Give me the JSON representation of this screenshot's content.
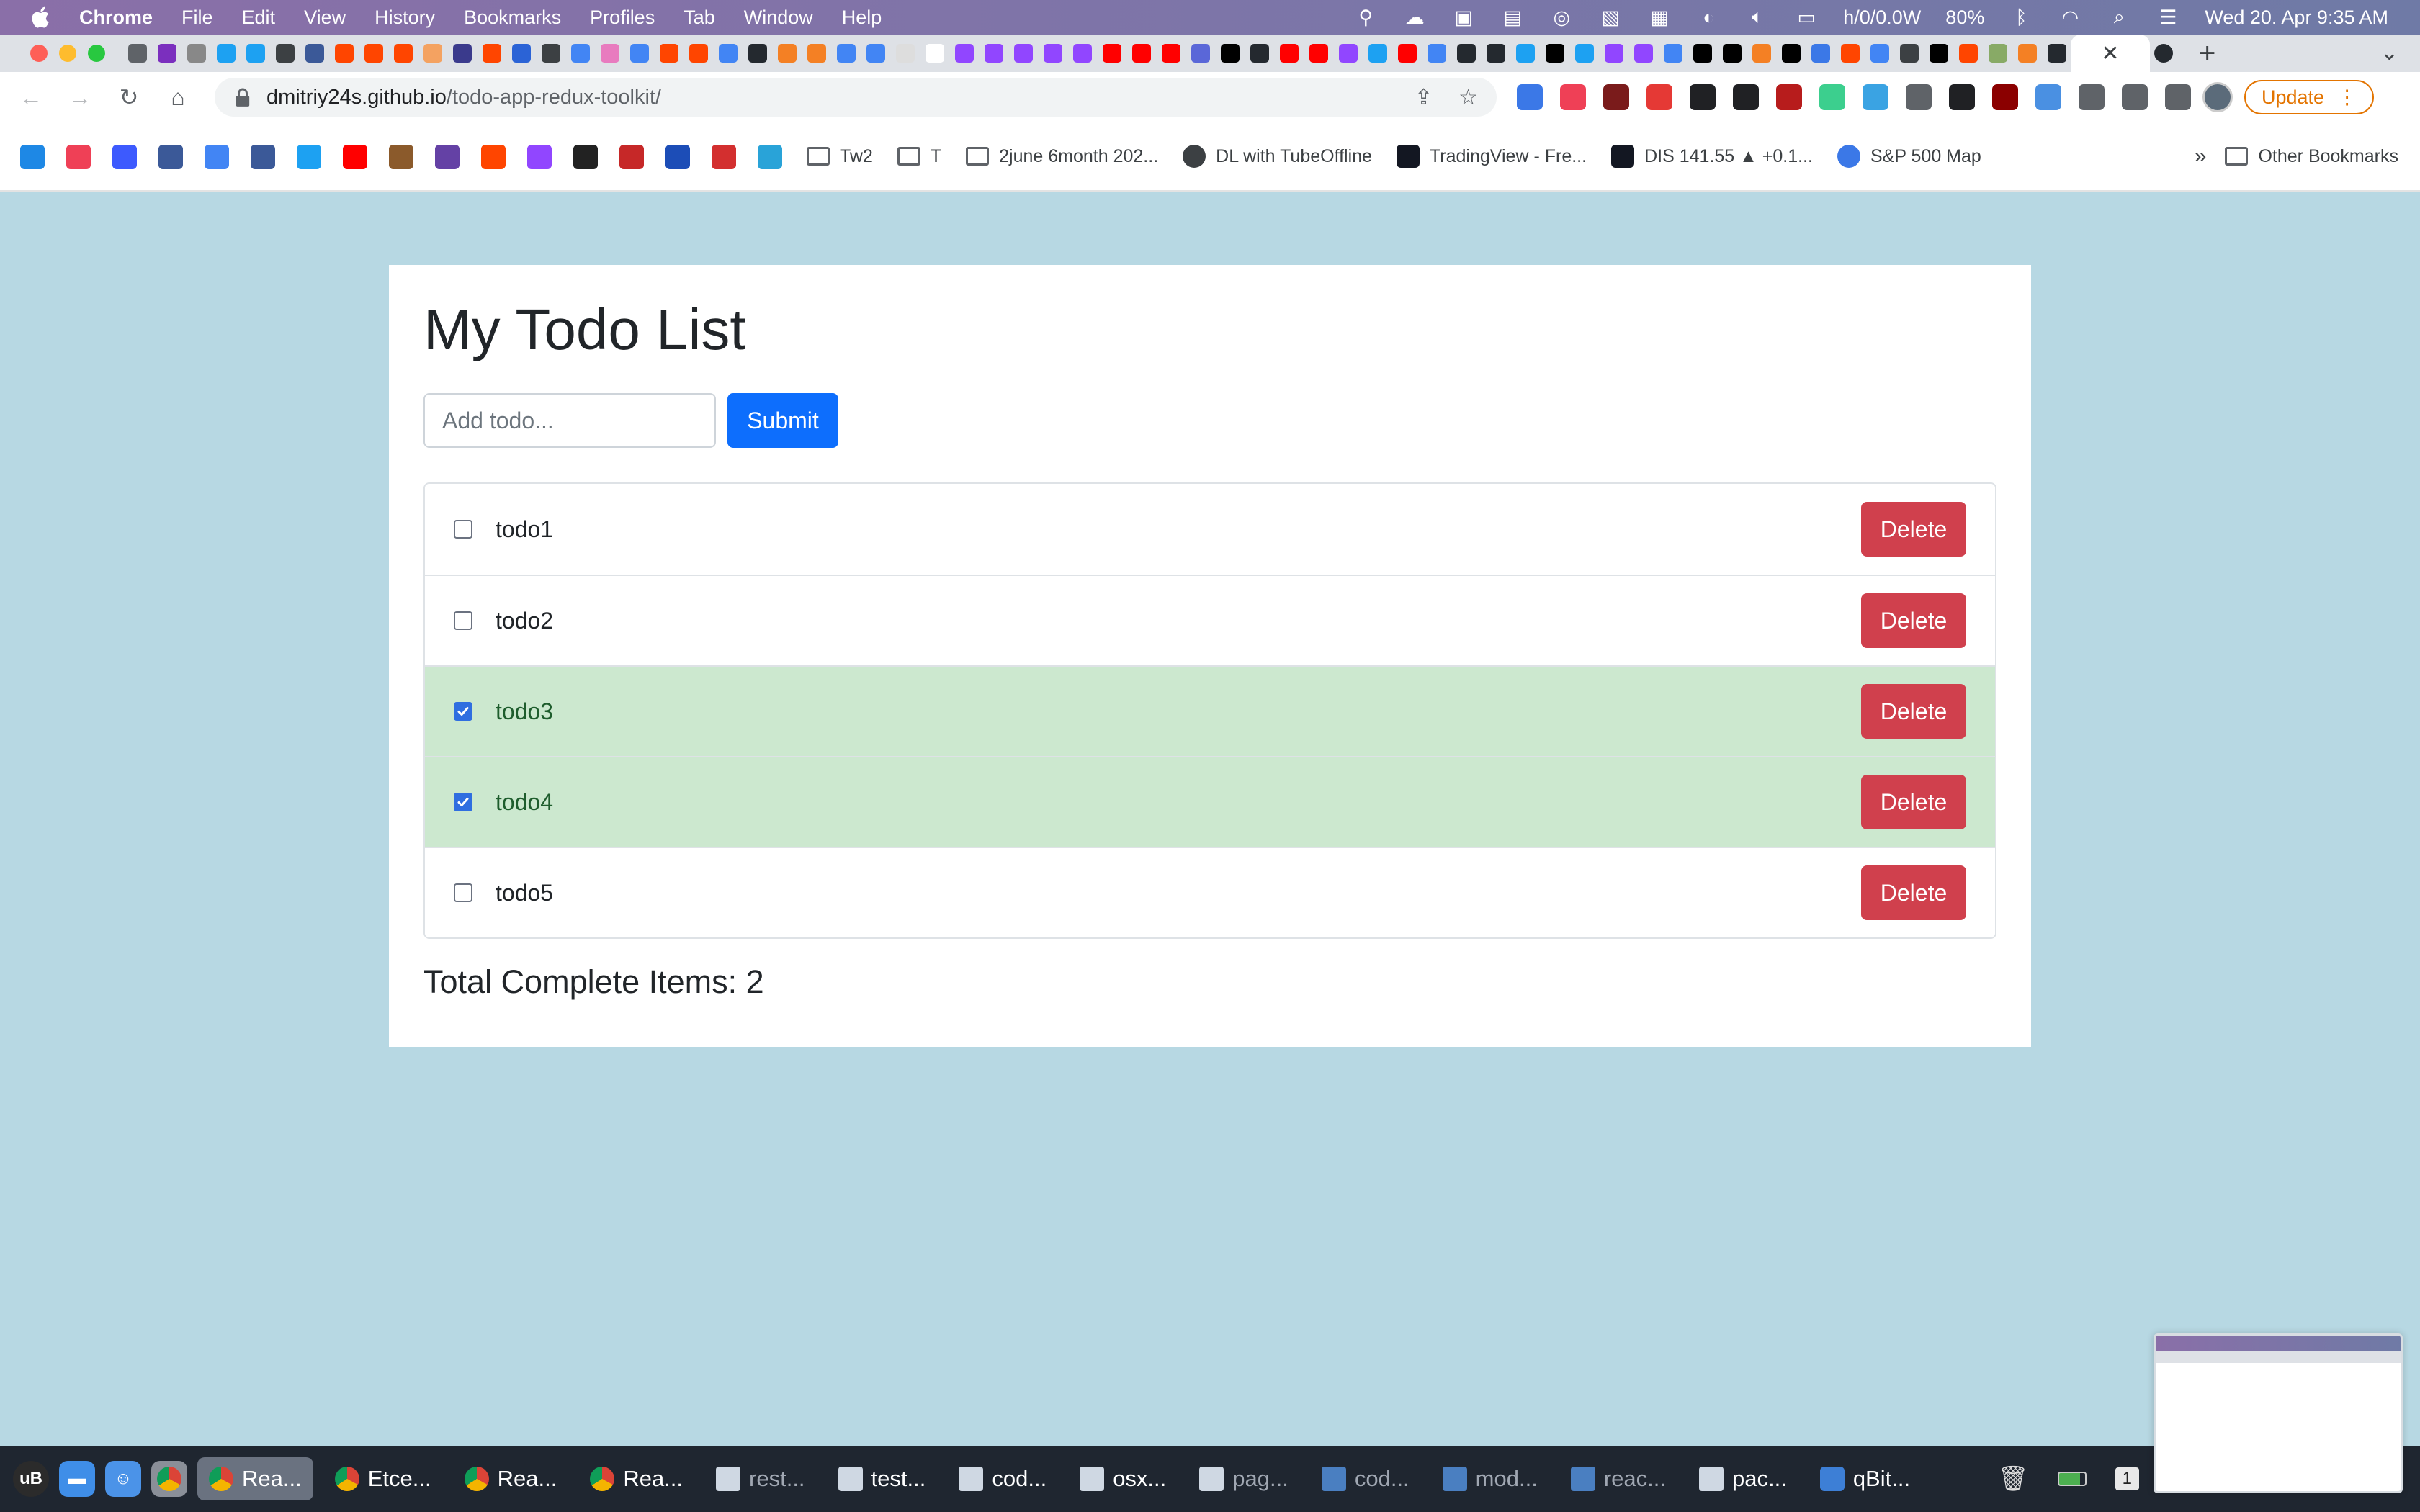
{
  "menubar": {
    "app": "Chrome",
    "items": [
      "File",
      "Edit",
      "View",
      "History",
      "Bookmarks",
      "Profiles",
      "Tab",
      "Window",
      "Help"
    ],
    "network": "h/0/0.0W",
    "battery": "80%",
    "datetime": "Wed 20. Apr  9:35 AM"
  },
  "browser": {
    "address_host": "dmitriy24s.github.io",
    "address_path": "/todo-app-redux-toolkit/",
    "update_label": "Update",
    "active_tab_close": "✕",
    "new_tab": "+"
  },
  "bookmarks": {
    "items": [
      {
        "label": "Tw2",
        "type": "folder"
      },
      {
        "label": "T",
        "type": "folder"
      },
      {
        "label": "2june 6month 202...",
        "type": "folder"
      },
      {
        "label": "DL with TubeOffline",
        "type": "link"
      },
      {
        "label": "TradingView - Fre...",
        "type": "link"
      },
      {
        "label": "DIS 141.55 ▲ +0.1...",
        "type": "link"
      },
      {
        "label": "S&P 500 Map",
        "type": "link"
      }
    ],
    "more": "»",
    "other": "Other Bookmarks"
  },
  "app": {
    "title": "My Todo List",
    "input_placeholder": "Add todo...",
    "submit_label": "Submit",
    "delete_label": "Delete",
    "todos": [
      {
        "label": "todo1",
        "completed": false
      },
      {
        "label": "todo2",
        "completed": false
      },
      {
        "label": "todo3",
        "completed": true
      },
      {
        "label": "todo4",
        "completed": true
      },
      {
        "label": "todo5",
        "completed": false
      }
    ],
    "total_label": "Total Complete Items: 2"
  },
  "dock": {
    "apps": [
      {
        "label": "Rea...",
        "active": true,
        "kind": "chrome"
      },
      {
        "label": "Etce...",
        "active": false,
        "kind": "chrome"
      },
      {
        "label": "Rea...",
        "active": false,
        "kind": "chrome"
      },
      {
        "label": "Rea...",
        "active": false,
        "kind": "chrome"
      },
      {
        "label": "rest...",
        "active": false,
        "kind": "doc-dim"
      },
      {
        "label": "test...",
        "active": false,
        "kind": "doc"
      },
      {
        "label": "cod...",
        "active": false,
        "kind": "doc"
      },
      {
        "label": "osx...",
        "active": false,
        "kind": "doc"
      },
      {
        "label": "pag...",
        "active": false,
        "kind": "doc-dim"
      },
      {
        "label": "cod...",
        "active": false,
        "kind": "folder-dim"
      },
      {
        "label": "mod...",
        "active": false,
        "kind": "folder-dim"
      },
      {
        "label": "reac...",
        "active": false,
        "kind": "folder-dim"
      },
      {
        "label": "pac...",
        "active": false,
        "kind": "doc"
      },
      {
        "label": "qBit...",
        "active": false,
        "kind": "qbit"
      }
    ],
    "badge": "1"
  },
  "colors": {
    "page_bg": "#b7d8e3",
    "primary": "#0d6efd",
    "danger": "#d0404d",
    "completed_row": "#cce8cf"
  }
}
